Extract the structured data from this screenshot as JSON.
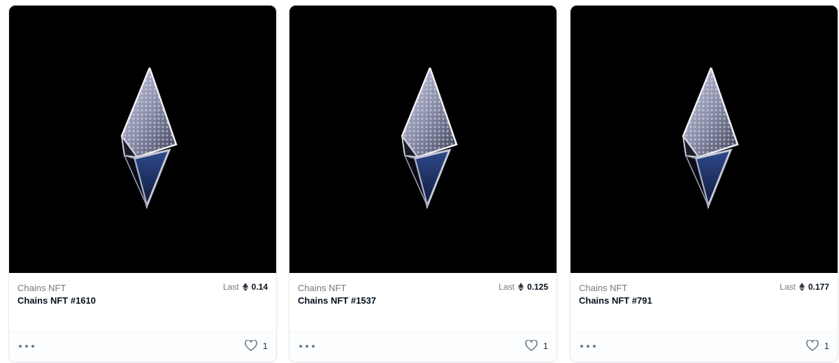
{
  "colors": {
    "media_background": "#000000",
    "text_primary": "#04111d",
    "text_secondary": "#707a83",
    "border": "#e5e8eb"
  },
  "cards": [
    {
      "collection": "Chains NFT",
      "name": "Chains NFT #1610",
      "price_label": "Last",
      "price_currency_icon": "ethereum-icon",
      "price_value": "0.14",
      "more_icon": "more-horizontal-icon",
      "favorite_icon": "heart-outline-icon",
      "favorite_count": "1"
    },
    {
      "collection": "Chains NFT",
      "name": "Chains NFT #1537",
      "price_label": "Last",
      "price_currency_icon": "ethereum-icon",
      "price_value": "0.125",
      "more_icon": "more-horizontal-icon",
      "favorite_icon": "heart-outline-icon",
      "favorite_count": "1"
    },
    {
      "collection": "Chains NFT",
      "name": "Chains NFT #791",
      "price_label": "Last",
      "price_currency_icon": "ethereum-icon",
      "price_value": "0.177",
      "more_icon": "more-horizontal-icon",
      "favorite_icon": "heart-outline-icon",
      "favorite_count": "1"
    }
  ]
}
